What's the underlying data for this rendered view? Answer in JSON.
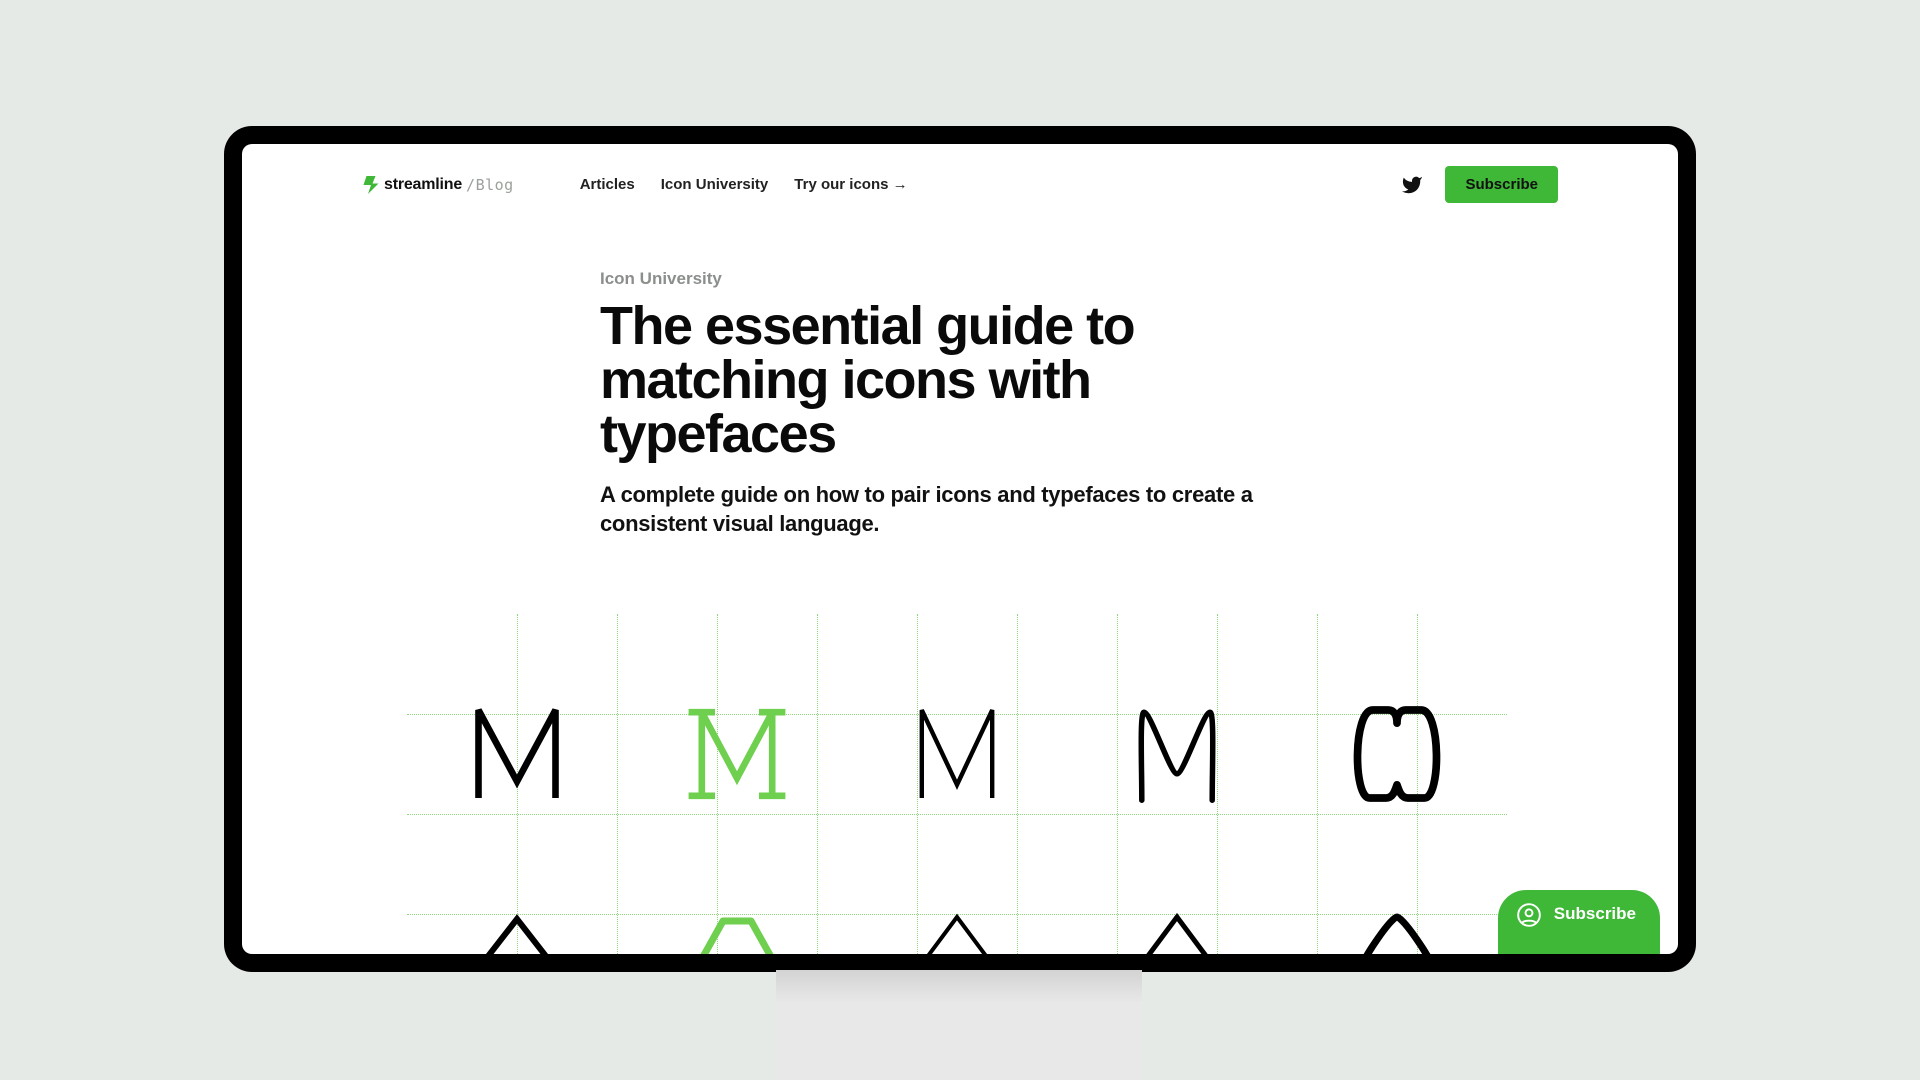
{
  "brand": {
    "name": "streamline",
    "suffix": "/Blog",
    "accent": "#3fb737"
  },
  "nav": {
    "items": [
      {
        "label": "Articles"
      },
      {
        "label": "Icon University"
      },
      {
        "label": "Try our icons →"
      }
    ]
  },
  "actions": {
    "subscribe_label": "Subscribe"
  },
  "article": {
    "category": "Icon University",
    "title": "The essential guide to matching icons with typefaces",
    "subtitle": "A complete guide on how to pair icons and typefaces to create a consistent visual language."
  },
  "float": {
    "subscribe_label": "Subscribe"
  }
}
